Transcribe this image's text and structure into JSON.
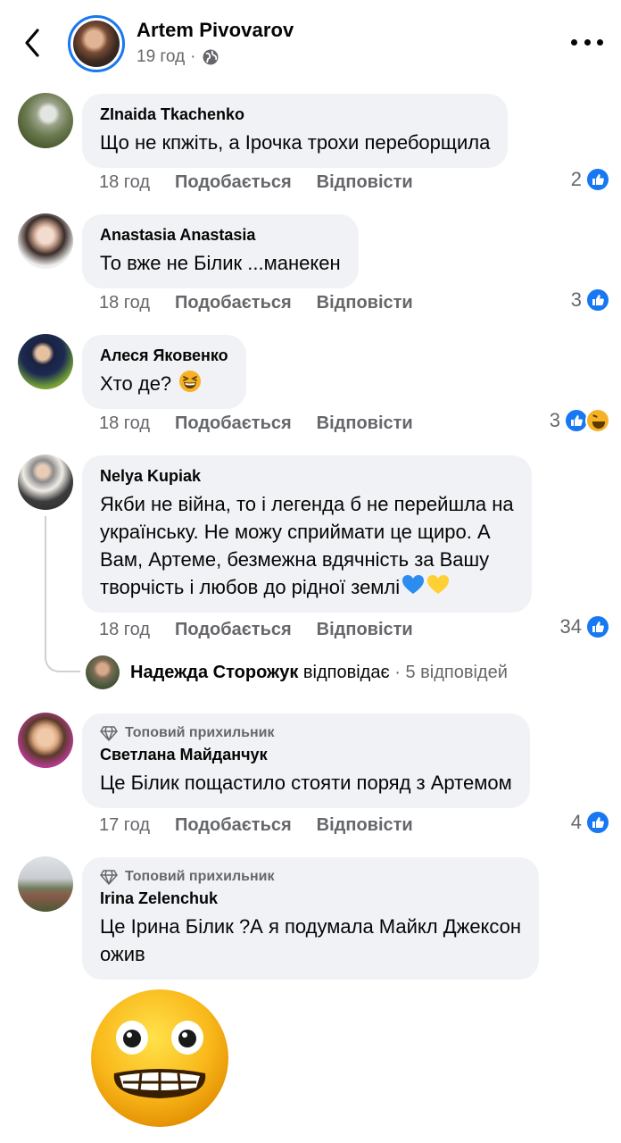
{
  "header": {
    "author": "Artem Pivovarov",
    "time": "19 год",
    "separator": "·"
  },
  "comments": [
    {
      "author": "ZInaida Tkachenko",
      "lines": [
        "Що не кпжіть, а Ірочка трохи переборщила"
      ],
      "time": "18 год",
      "like_label": "Подобається",
      "reply_label": "Відповісти",
      "reaction_count": "2",
      "reactions": [
        "like-icon"
      ]
    },
    {
      "author": "Anastasia Anastasia",
      "lines": [
        "То вже не Білик ...манекен"
      ],
      "time": "18 год",
      "like_label": "Подобається",
      "reply_label": "Відповісти",
      "reaction_count": "3",
      "reactions": [
        "like-icon"
      ]
    },
    {
      "author": "Алеся Яковенко",
      "lines": [
        "Хто де?"
      ],
      "emoji": "grinning-squinting-face",
      "time": "18 год",
      "like_label": "Подобається",
      "reply_label": "Відповісти",
      "reaction_count": "3",
      "reactions": [
        "like-icon",
        "haha-icon"
      ]
    },
    {
      "author": "Nelya Kupiak",
      "lines": [
        "Якби не війна, то і легенда б не перейшла на",
        "українську. Не можу сприймати це щиро. А",
        "Вам, Артеме, безмежна вдячність за Вашу",
        "творчість і любов до рідної землі"
      ],
      "emoji": "blue-heart yellow-heart",
      "time": "18 год",
      "like_label": "Подобається",
      "reply_label": "Відповісти",
      "reaction_count": "34",
      "reactions": [
        "like-icon"
      ],
      "reply_preview": {
        "name": "Надежда Сторожук",
        "action": "відповідає",
        "separator": "·",
        "count": "5 відповідей"
      }
    },
    {
      "badge": "Топовий прихильник",
      "author": "Светлана Майданчук",
      "lines": [
        "Це Білик пощастило стояти поряд з Артемом"
      ],
      "time": "17 год",
      "like_label": "Подобається",
      "reply_label": "Відповісти",
      "reaction_count": "4",
      "reactions": [
        "like-icon"
      ]
    },
    {
      "badge": "Топовий прихильник",
      "author": "Irina Zelenchuk",
      "lines": [
        "Це Ірина Білик ?А я подумала Майкл Джексон",
        "ожив"
      ],
      "sticker": "grimacing-face"
    }
  ],
  "colors": {
    "accent": "#1877f2",
    "bubble": "#f0f2f5",
    "secondary_text": "#65676b"
  }
}
